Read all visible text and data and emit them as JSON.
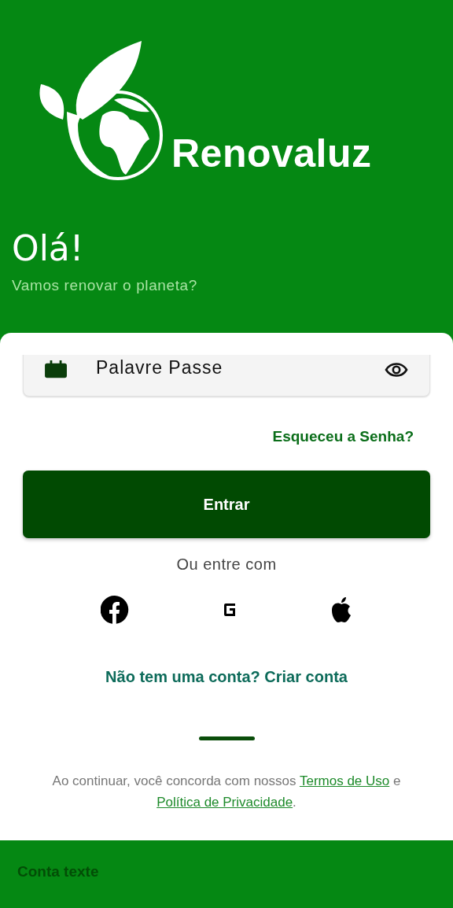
{
  "brand": {
    "name": "Renovaluz"
  },
  "greeting": {
    "title": "Olá!",
    "subtitle": "Vamos renovar o planeta?"
  },
  "password_field": {
    "placeholder": "Palavre Passe"
  },
  "forgot_link": "Esqueceu a Senha?",
  "login_button": "Entrar",
  "social": {
    "label": "Ou entre com",
    "providers": [
      {
        "kind": "facebook"
      },
      {
        "kind": "google"
      },
      {
        "kind": "apple"
      }
    ]
  },
  "signup_link": "Não tem uma conta? Criar conta",
  "terms": {
    "text": "Ao continuar, você concorda com nossos",
    "terms_link": "Termos de Uso",
    "conjunction": "e",
    "privacy_link": "Política de Privacidade",
    "end": "."
  },
  "footer": {
    "text": "Conta texte"
  }
}
